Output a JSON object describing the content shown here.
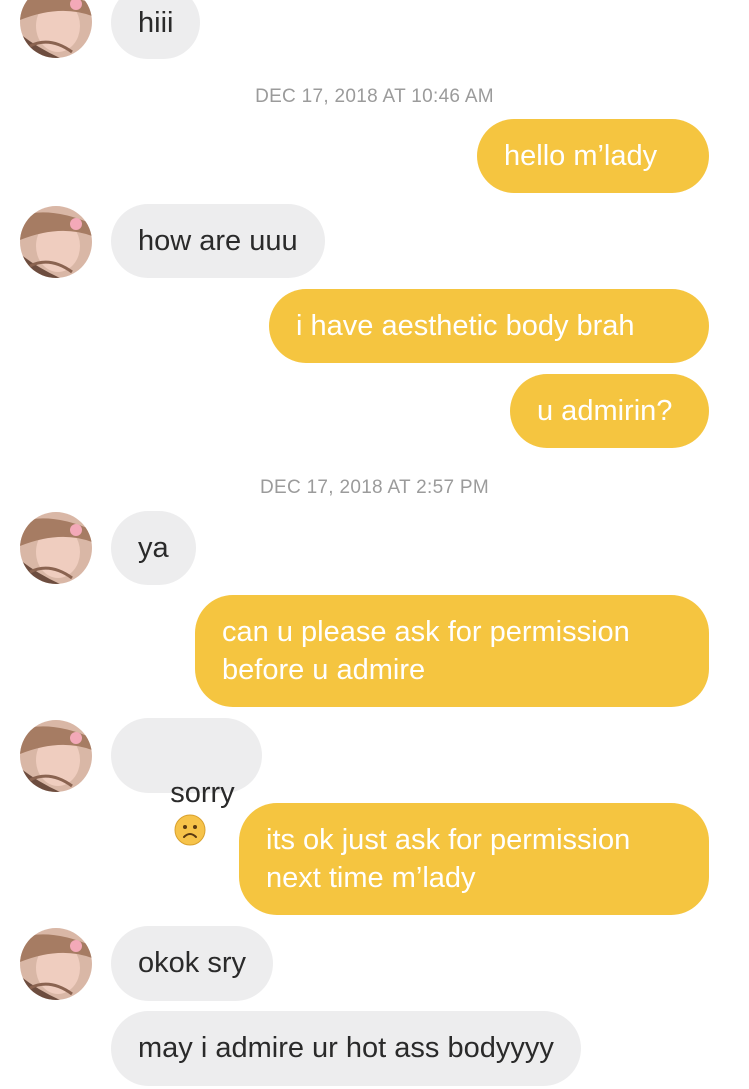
{
  "conversation": {
    "messages": [
      {
        "text": "hiii"
      },
      {
        "text": "hello m’lady"
      },
      {
        "text": "how are uuu"
      },
      {
        "text": "i have aesthetic body brah"
      },
      {
        "text": "u admirin?"
      },
      {
        "text": "ya"
      },
      {
        "text": "can u please ask for permission\nbefore u admire"
      },
      {
        "text": "sorry"
      },
      {
        "text": "its ok just ask for permission\nnext time m’lady"
      },
      {
        "text": "okok sry"
      },
      {
        "text": "may i admire ur hot ass bodyyyy"
      }
    ],
    "timestamps": [
      "DEC 17, 2018 AT 10:46 AM",
      "DEC 17, 2018 AT 2:57 PM"
    ],
    "emoji": "frowning-face-emoji"
  },
  "colors": {
    "incoming_bubble": "#ededee",
    "outgoing_bubble": "#f5c540",
    "timestamp_text": "#9b9b9b"
  }
}
